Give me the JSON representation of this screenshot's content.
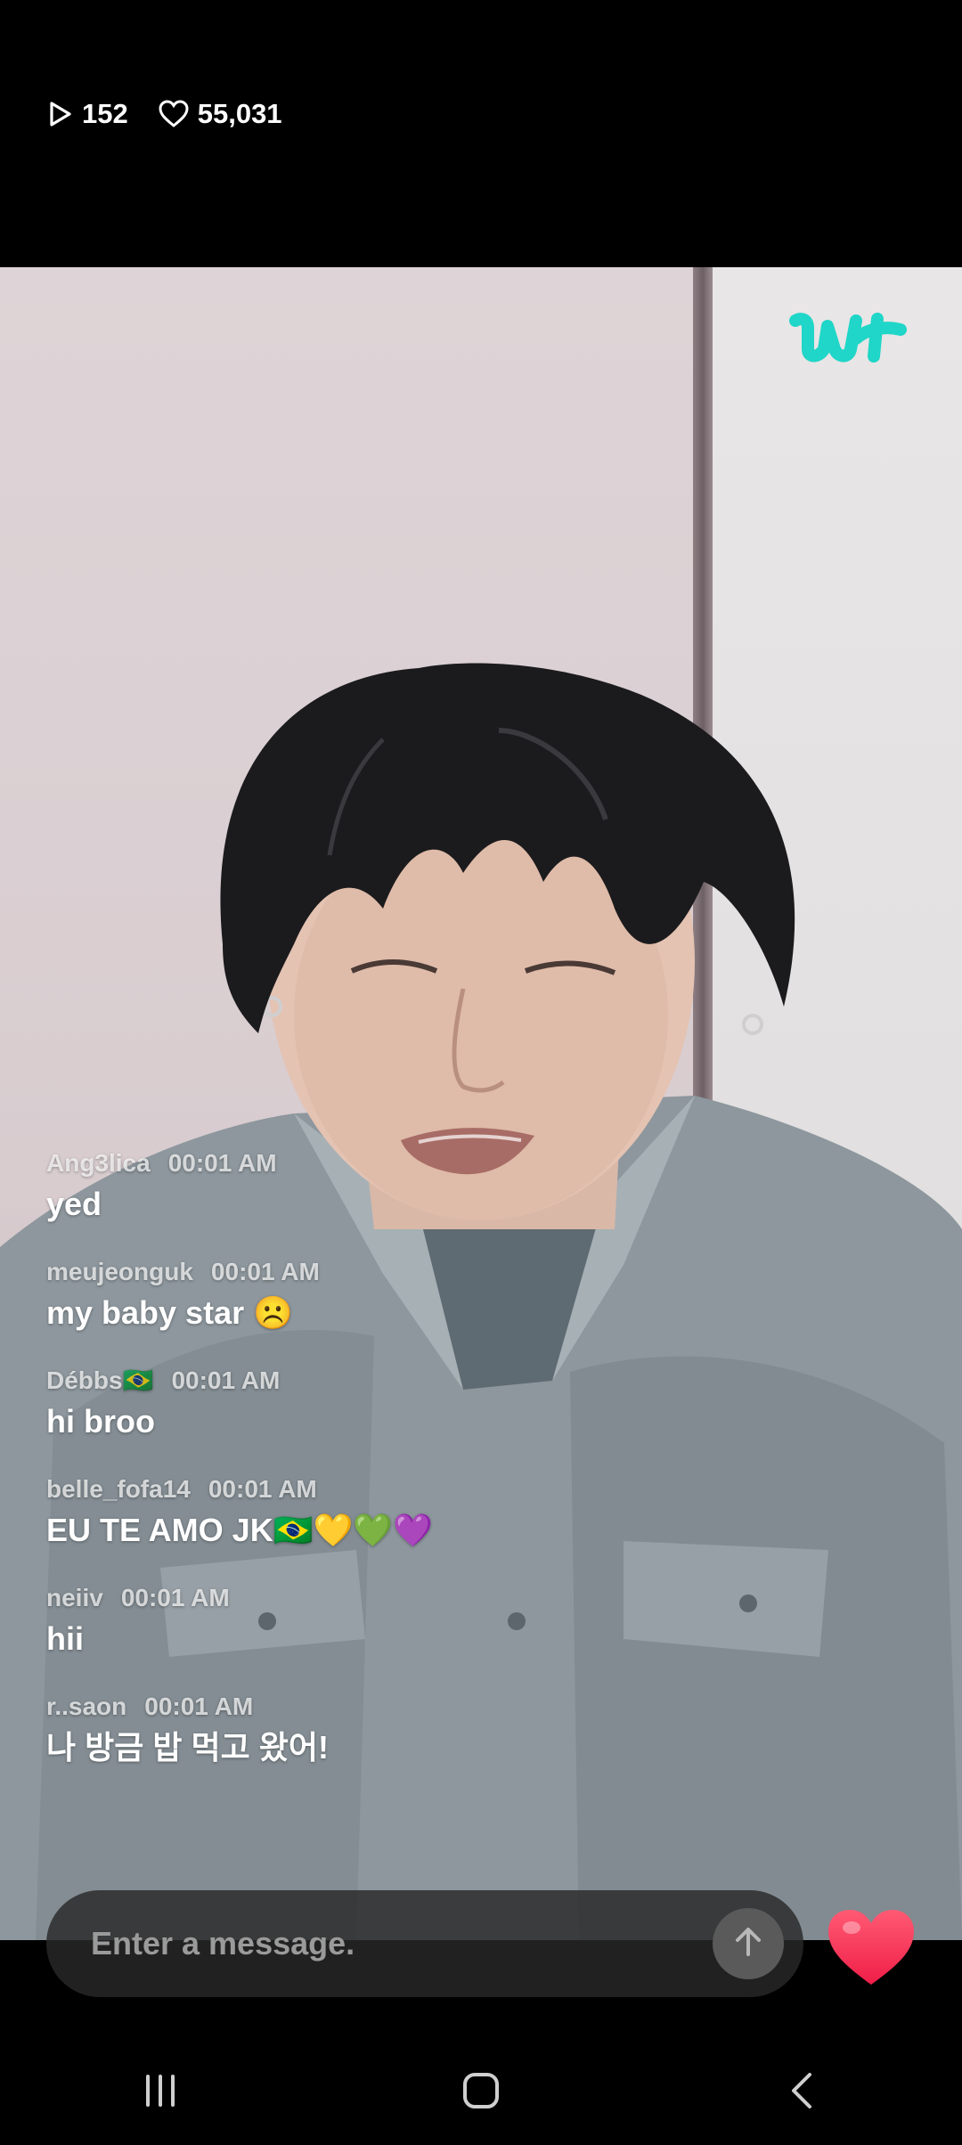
{
  "stats": {
    "plays": "152",
    "likes": "55,031"
  },
  "icons": {
    "plays": "play-icon",
    "likes": "heart-outline-icon",
    "watermark": "weverse-logo-icon",
    "send": "arrow-up-icon",
    "heart": "heart-filled-icon"
  },
  "colors": {
    "accent_logo": "#1fd6c8",
    "heart": "#ff3b5c"
  },
  "chat": {
    "messages": [
      {
        "user": "Ang3lica",
        "time": "00:01 AM",
        "text": "yed"
      },
      {
        "user": "meujeonguk",
        "time": "00:01 AM",
        "text": "my baby star ☹️"
      },
      {
        "user": "Débbs🇧🇷",
        "time": "00:01 AM",
        "text": "hi broo"
      },
      {
        "user": "belle_fofa14",
        "time": "00:01 AM",
        "text": "EU TE AMO JK🇧🇷💛💚💜"
      },
      {
        "user": "neiiv",
        "time": "00:01 AM",
        "text": "hii"
      },
      {
        "user": "r..saon",
        "time": "00:01 AM",
        "text": "나 방금 밥 먹고 왔어!"
      }
    ]
  },
  "input": {
    "placeholder": "Enter a message."
  }
}
